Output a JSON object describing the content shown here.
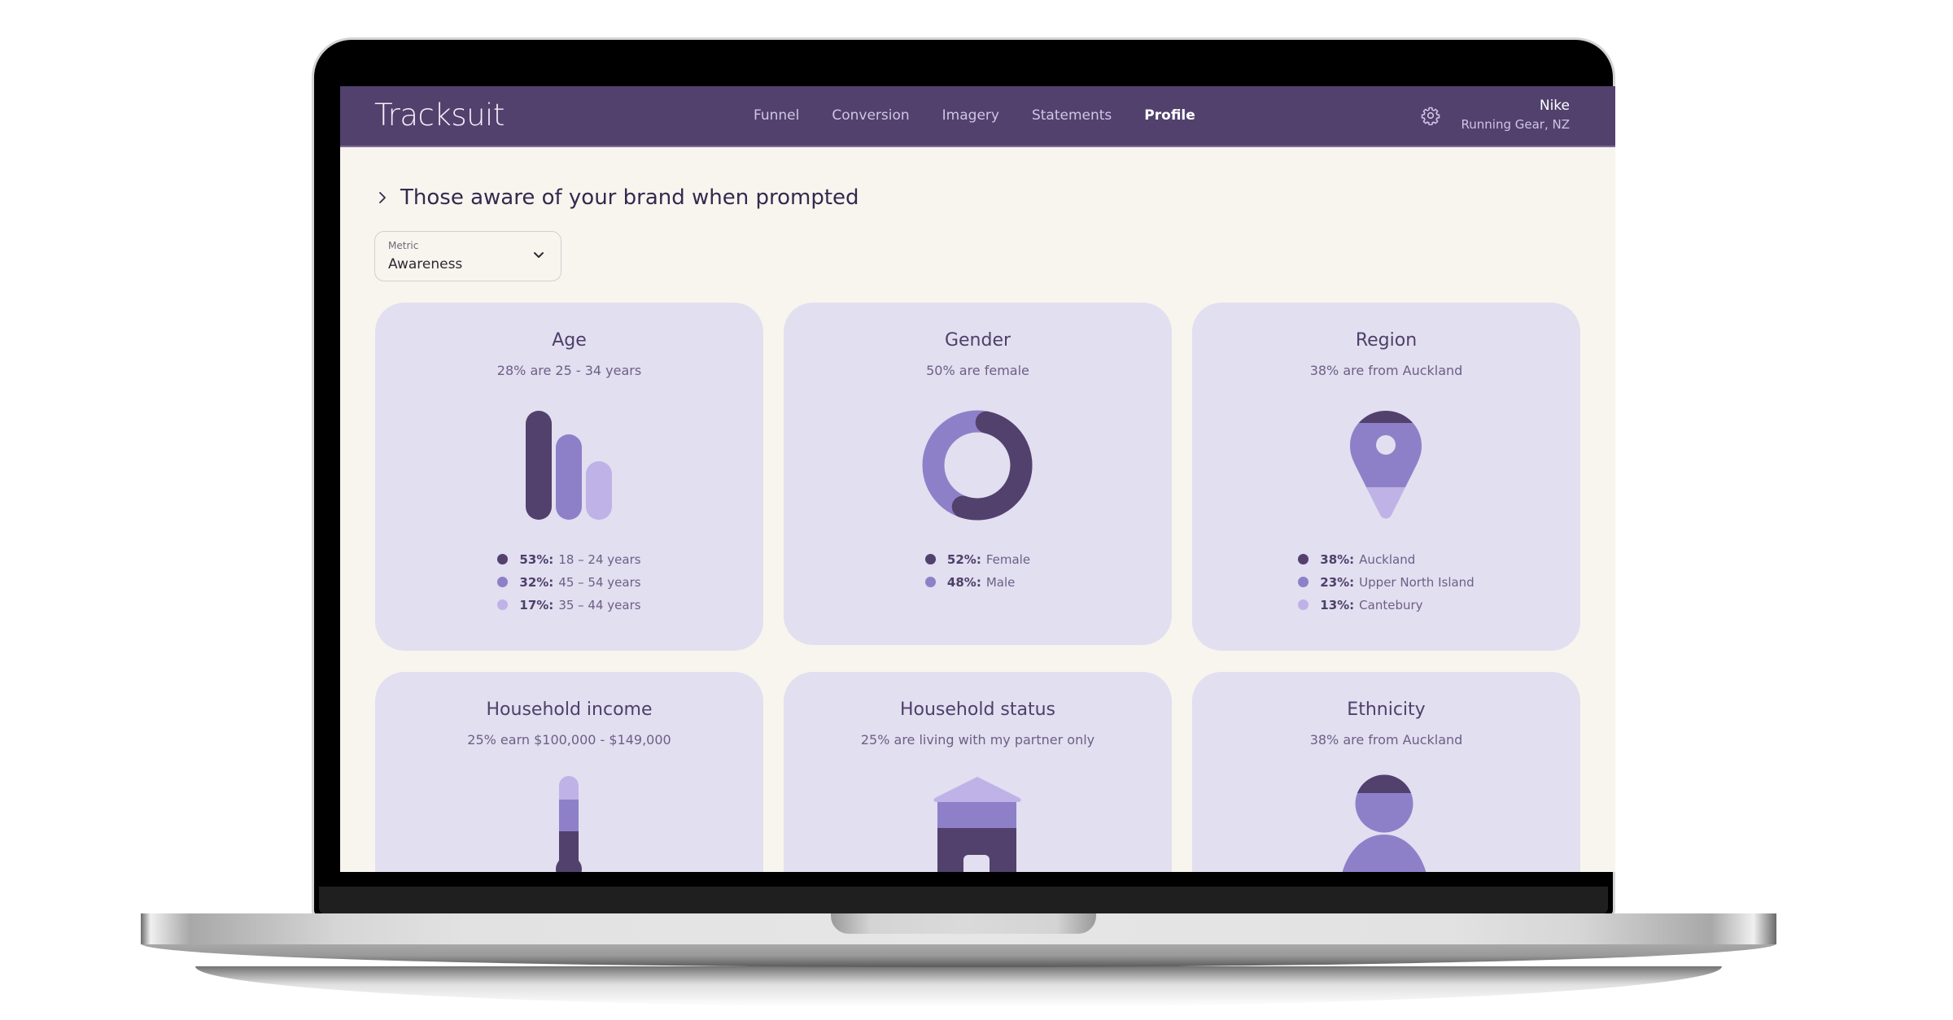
{
  "app": {
    "logo": "Tracksuit",
    "nav": [
      {
        "label": "Funnel",
        "active": false
      },
      {
        "label": "Conversion",
        "active": false
      },
      {
        "label": "Imagery",
        "active": false
      },
      {
        "label": "Statements",
        "active": false
      },
      {
        "label": "Profile",
        "active": true
      }
    ],
    "settings_icon": "gear-icon",
    "account": {
      "name": "Nike",
      "subtitle": "Running Gear, NZ"
    }
  },
  "colors": {
    "nav_bg": "#52416d",
    "page_bg": "#f8f5ef",
    "card_bg": "#e2dff0",
    "dark": "#52416d",
    "mid": "#8e80c8",
    "light": "#bfb2e6"
  },
  "page": {
    "section_title": "Those aware of your brand when prompted",
    "section_icon": "chevron-right-icon",
    "metric": {
      "label": "Metric",
      "value": "Awareness",
      "icon": "chevron-down-icon"
    }
  },
  "cards": [
    {
      "id": "age",
      "title": "Age",
      "subtitle": "28% are 25 - 34 years",
      "figure": "bar-pills",
      "legend": [
        {
          "pct": "53%:",
          "label": "18 – 24 years",
          "value": 53,
          "shade": "dark"
        },
        {
          "pct": "32%:",
          "label": "45 – 54 years",
          "value": 32,
          "shade": "mid"
        },
        {
          "pct": "17%:",
          "label": "35 – 44 years",
          "value": 17,
          "shade": "light"
        }
      ]
    },
    {
      "id": "gender",
      "title": "Gender",
      "subtitle": "50% are female",
      "figure": "donut",
      "legend": [
        {
          "pct": "52%:",
          "label": "Female",
          "value": 52,
          "shade": "dark"
        },
        {
          "pct": "48%:",
          "label": "Male",
          "value": 48,
          "shade": "mid"
        }
      ]
    },
    {
      "id": "region",
      "title": "Region",
      "subtitle": "38% are from Auckland",
      "figure": "map-pin",
      "legend": [
        {
          "pct": "38%:",
          "label": "Auckland",
          "value": 38,
          "shade": "dark"
        },
        {
          "pct": "23%:",
          "label": "Upper North Island",
          "value": 23,
          "shade": "mid"
        },
        {
          "pct": "13%:",
          "label": "Cantebury",
          "value": 13,
          "shade": "light"
        }
      ]
    },
    {
      "id": "household-income",
      "title": "Household income",
      "subtitle": "25% earn $100,000 - $149,000",
      "figure": "thermometer"
    },
    {
      "id": "household-status",
      "title": "Household status",
      "subtitle": "25% are living with my partner only",
      "figure": "house"
    },
    {
      "id": "ethnicity",
      "title": "Ethnicity",
      "subtitle": "38% are from Auckland",
      "figure": "person"
    }
  ]
}
